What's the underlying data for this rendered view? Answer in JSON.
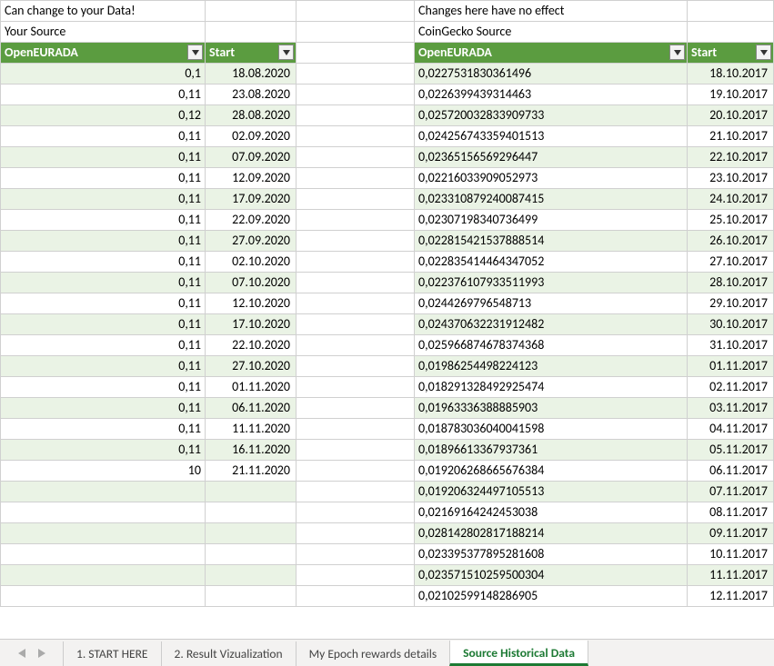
{
  "notes": {
    "left_top": "Can change to your Data!",
    "left_sub": "Your Source",
    "right_top": "Changes here have no effect",
    "right_sub": "CoinGecko Source"
  },
  "headers": {
    "left_val": "OpenEURADA",
    "left_date": "Start",
    "right_val": "OpenEURADA",
    "right_date": "Start"
  },
  "left_rows": [
    {
      "v": "0,1",
      "d": "18.08.2020"
    },
    {
      "v": "0,11",
      "d": "23.08.2020"
    },
    {
      "v": "0,12",
      "d": "28.08.2020"
    },
    {
      "v": "0,11",
      "d": "02.09.2020"
    },
    {
      "v": "0,11",
      "d": "07.09.2020"
    },
    {
      "v": "0,11",
      "d": "12.09.2020"
    },
    {
      "v": "0,11",
      "d": "17.09.2020"
    },
    {
      "v": "0,11",
      "d": "22.09.2020"
    },
    {
      "v": "0,11",
      "d": "27.09.2020"
    },
    {
      "v": "0,11",
      "d": "02.10.2020"
    },
    {
      "v": "0,11",
      "d": "07.10.2020"
    },
    {
      "v": "0,11",
      "d": "12.10.2020"
    },
    {
      "v": "0,11",
      "d": "17.10.2020"
    },
    {
      "v": "0,11",
      "d": "22.10.2020"
    },
    {
      "v": "0,11",
      "d": "27.10.2020"
    },
    {
      "v": "0,11",
      "d": "01.11.2020"
    },
    {
      "v": "0,11",
      "d": "06.11.2020"
    },
    {
      "v": "0,11",
      "d": "11.11.2020"
    },
    {
      "v": "0,11",
      "d": "16.11.2020"
    },
    {
      "v": "10",
      "d": "21.11.2020"
    },
    {
      "v": "",
      "d": ""
    },
    {
      "v": "",
      "d": ""
    },
    {
      "v": "",
      "d": ""
    },
    {
      "v": "",
      "d": ""
    },
    {
      "v": "",
      "d": ""
    },
    {
      "v": "",
      "d": ""
    }
  ],
  "right_rows": [
    {
      "v": "0,0227531830361496",
      "d": "18.10.2017"
    },
    {
      "v": "0,0226399439314463",
      "d": "19.10.2017"
    },
    {
      "v": "0,025720032833909733",
      "d": "20.10.2017"
    },
    {
      "v": "0,024256743359401513",
      "d": "21.10.2017"
    },
    {
      "v": "0,02365156569296447",
      "d": "22.10.2017"
    },
    {
      "v": "0,02216033909052973",
      "d": "23.10.2017"
    },
    {
      "v": "0,023310879240087415",
      "d": "24.10.2017"
    },
    {
      "v": "0,02307198340736499",
      "d": "25.10.2017"
    },
    {
      "v": "0,022815421537888514",
      "d": "26.10.2017"
    },
    {
      "v": "0,022835414464347052",
      "d": "27.10.2017"
    },
    {
      "v": "0,022376107933511993",
      "d": "28.10.2017"
    },
    {
      "v": "0,0244269796548713",
      "d": "29.10.2017"
    },
    {
      "v": "0,024370632231912482",
      "d": "30.10.2017"
    },
    {
      "v": "0,025966874678374368",
      "d": "31.10.2017"
    },
    {
      "v": "0,01986254498224123",
      "d": "01.11.2017"
    },
    {
      "v": "0,018291328492925474",
      "d": "02.11.2017"
    },
    {
      "v": "0,01963336388885903",
      "d": "03.11.2017"
    },
    {
      "v": "0,018783036040041598",
      "d": "04.11.2017"
    },
    {
      "v": "0,01896613367937361",
      "d": "05.11.2017"
    },
    {
      "v": "0,019206268665676384",
      "d": "06.11.2017"
    },
    {
      "v": "0,019206324497105513",
      "d": "07.11.2017"
    },
    {
      "v": "0,02169164242453038",
      "d": "08.11.2017"
    },
    {
      "v": "0,028142802817188214",
      "d": "09.11.2017"
    },
    {
      "v": "0,023395377895281608",
      "d": "10.11.2017"
    },
    {
      "v": "0,023571510259500304",
      "d": "11.11.2017"
    },
    {
      "v": "0,02102599148286905",
      "d": "12.11.2017"
    }
  ],
  "tabs": {
    "t1": "1. START HERE",
    "t2": "2. Result Vizualization",
    "t3": "My Epoch rewards details",
    "t4": "Source Historical Data"
  }
}
